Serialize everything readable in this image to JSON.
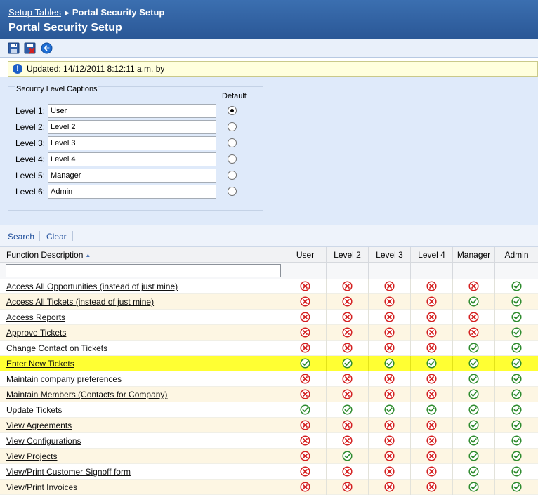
{
  "header": {
    "breadcrumb_link": "Setup Tables",
    "breadcrumb_current": "Portal Security Setup",
    "title": "Portal Security Setup"
  },
  "toolbar": {
    "buttons": [
      {
        "name": "save-button",
        "icon": "floppy-disk-icon"
      },
      {
        "name": "save-close-button",
        "icon": "save-close-icon"
      },
      {
        "name": "back-button",
        "icon": "back-arrow-icon"
      }
    ]
  },
  "info": {
    "icon": "info-icon",
    "text": "Updated:  14/12/2011 8:12:11 a.m. by"
  },
  "captions": {
    "group_title": "Security Level Captions",
    "default_label": "Default",
    "levels": [
      {
        "label": "Level 1:",
        "value": "User",
        "default": true
      },
      {
        "label": "Level 2:",
        "value": "Level 2",
        "default": false
      },
      {
        "label": "Level 3:",
        "value": "Level 3",
        "default": false
      },
      {
        "label": "Level 4:",
        "value": "Level 4",
        "default": false
      },
      {
        "label": "Level 5:",
        "value": "Manager",
        "default": false
      },
      {
        "label": "Level 6:",
        "value": "Admin",
        "default": false
      }
    ]
  },
  "search_bar": {
    "search_label": "Search",
    "clear_label": "Clear"
  },
  "grid": {
    "columns": [
      "Function Description",
      "User",
      "Level 2",
      "Level 3",
      "Level 4",
      "Manager",
      "Admin"
    ],
    "filter_value": "",
    "colors": {
      "allowed": "#2e8b2e",
      "denied": "#d42020",
      "highlight": "#ffff33"
    },
    "rows": [
      {
        "name": "Access All Opportunities (instead of just mine)",
        "perms": [
          false,
          false,
          false,
          false,
          false,
          true
        ]
      },
      {
        "name": "Access All Tickets (instead of just mine)",
        "perms": [
          false,
          false,
          false,
          false,
          true,
          true
        ]
      },
      {
        "name": "Access Reports",
        "perms": [
          false,
          false,
          false,
          false,
          false,
          true
        ]
      },
      {
        "name": "Approve Tickets",
        "perms": [
          false,
          false,
          false,
          false,
          false,
          true
        ]
      },
      {
        "name": "Change Contact on Tickets",
        "perms": [
          false,
          false,
          false,
          false,
          true,
          true
        ]
      },
      {
        "name": "Enter New Tickets",
        "perms": [
          true,
          true,
          true,
          true,
          true,
          true
        ],
        "highlight": true
      },
      {
        "name": "Maintain company preferences",
        "perms": [
          false,
          false,
          false,
          false,
          true,
          true
        ]
      },
      {
        "name": "Maintain Members (Contacts for Company)",
        "perms": [
          false,
          false,
          false,
          false,
          true,
          true
        ]
      },
      {
        "name": "Update Tickets",
        "perms": [
          true,
          true,
          true,
          true,
          true,
          true
        ]
      },
      {
        "name": "View Agreements",
        "perms": [
          false,
          false,
          false,
          false,
          true,
          true
        ]
      },
      {
        "name": "View Configurations",
        "perms": [
          false,
          false,
          false,
          false,
          true,
          true
        ]
      },
      {
        "name": "View Projects",
        "perms": [
          false,
          true,
          false,
          false,
          true,
          true
        ]
      },
      {
        "name": "View/Print Customer Signoff form",
        "perms": [
          false,
          false,
          false,
          false,
          true,
          true
        ]
      },
      {
        "name": "View/Print Invoices",
        "perms": [
          false,
          false,
          false,
          false,
          true,
          true
        ]
      }
    ]
  }
}
